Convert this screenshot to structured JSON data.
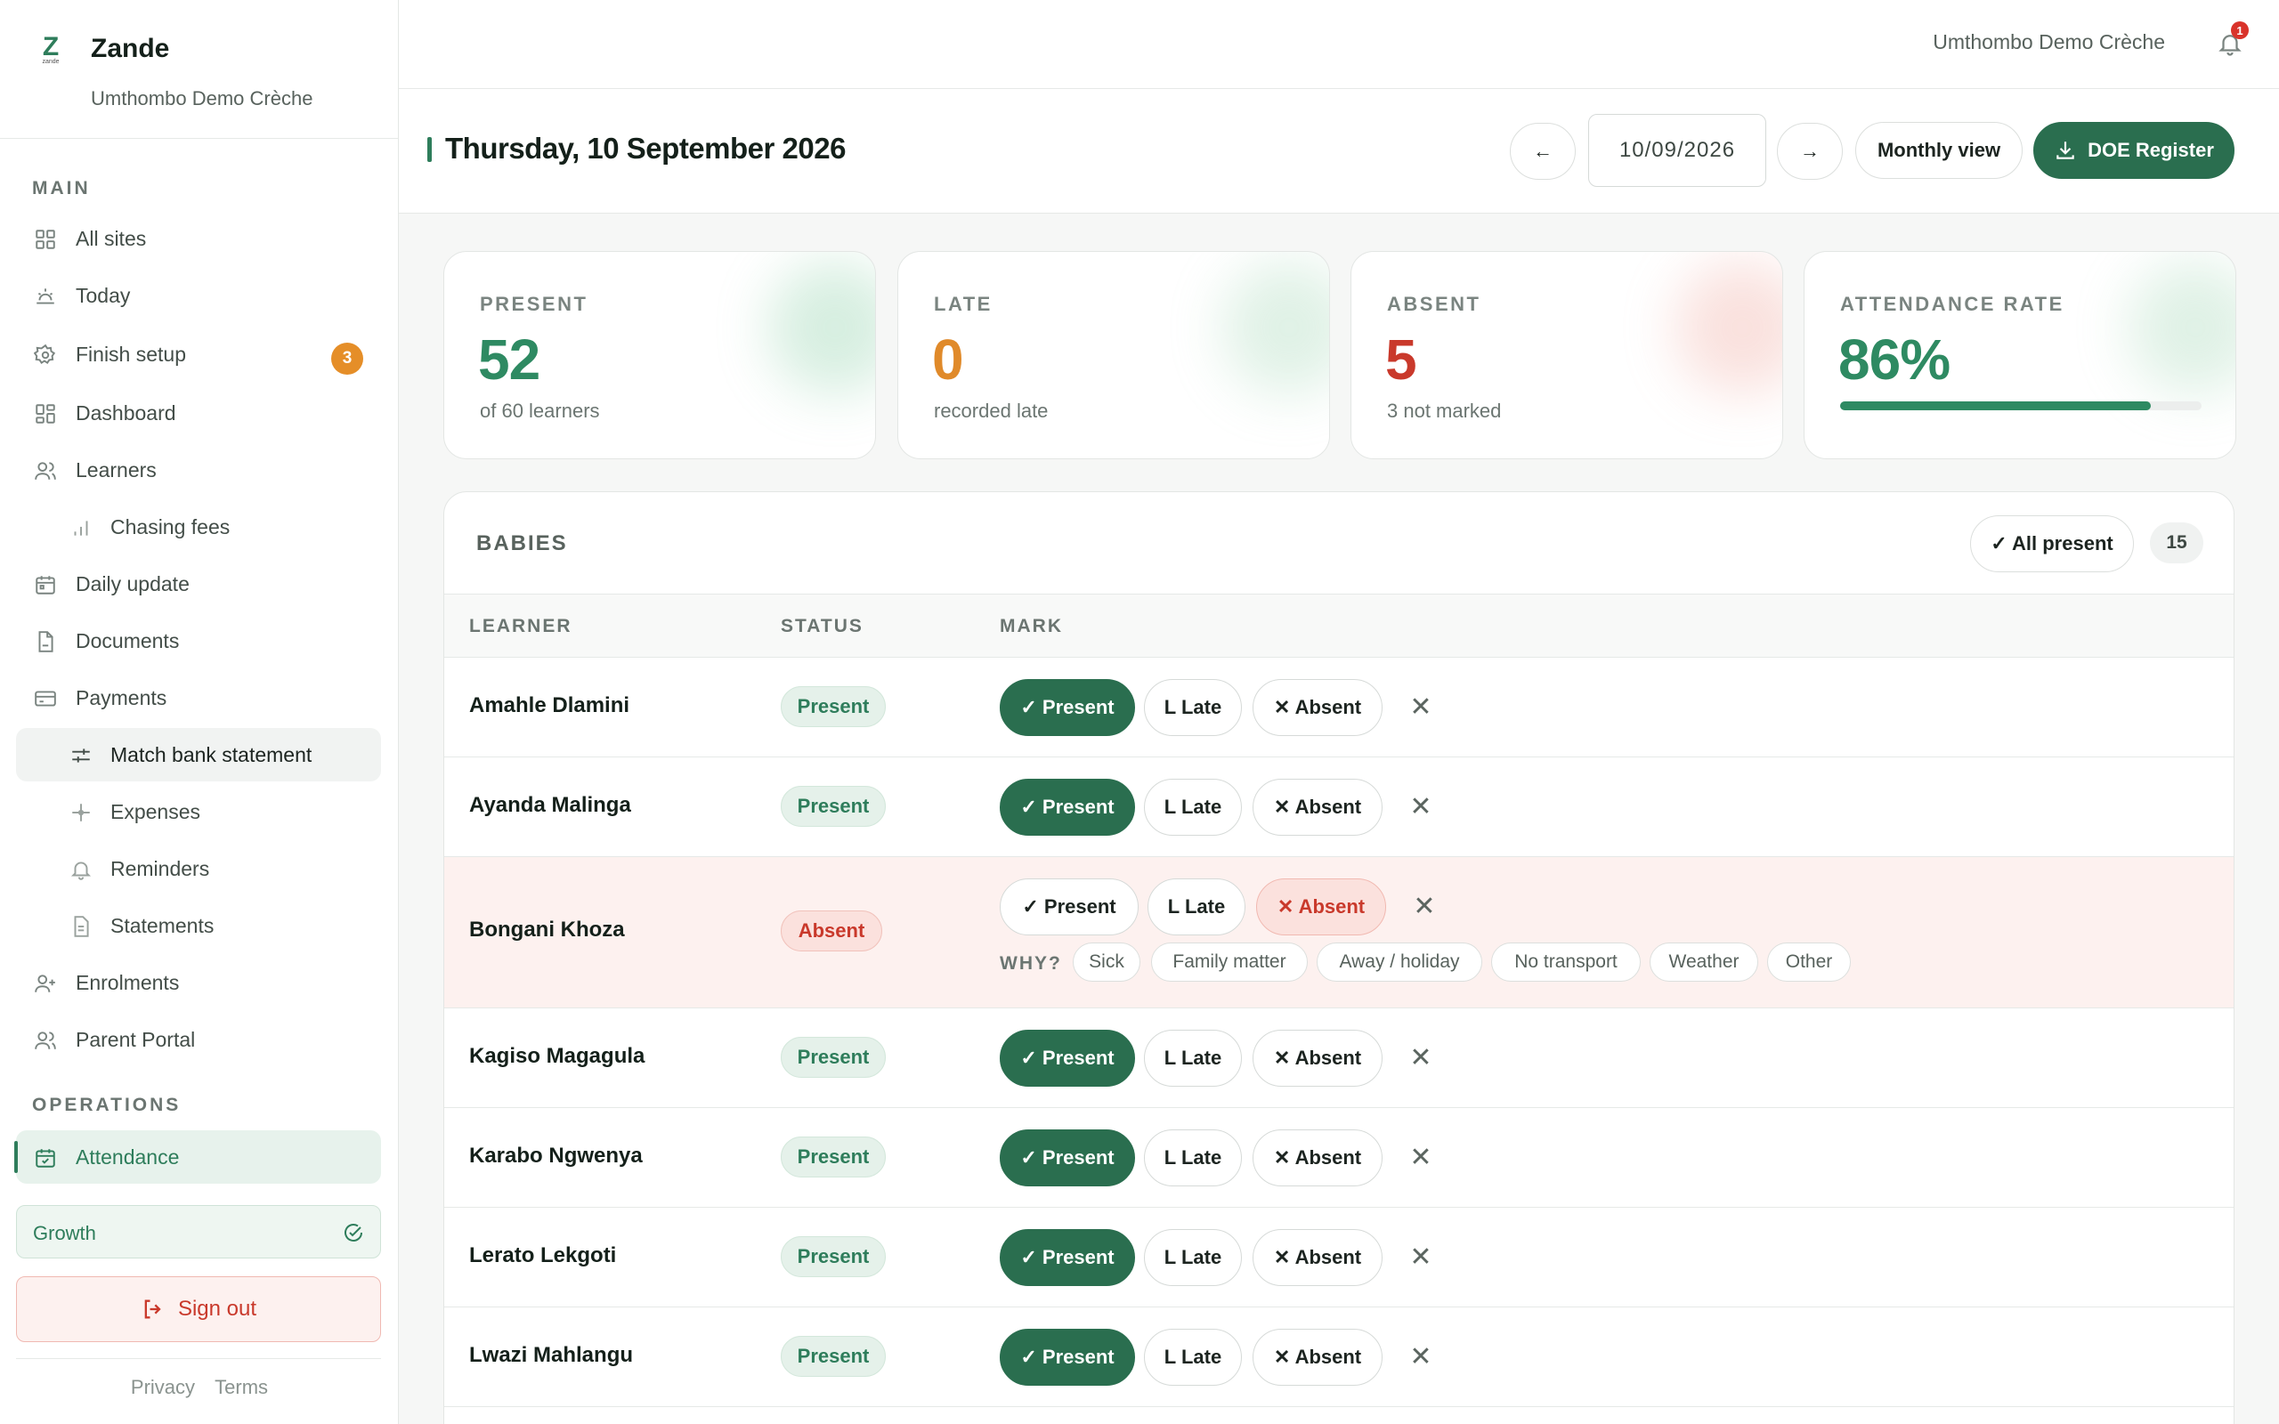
{
  "app": {
    "name": "Zande",
    "org": "Umthombo Demo Crèche",
    "logo_letter": "Z",
    "logo_word": "zande"
  },
  "sidebar": {
    "main_label": "MAIN",
    "items": [
      {
        "label": "All sites",
        "icon": "grid-icon"
      },
      {
        "label": "Today",
        "icon": "sun-icon"
      },
      {
        "label": "Finish setup",
        "icon": "gear-icon",
        "badge": "3"
      },
      {
        "label": "Dashboard",
        "icon": "dashboard-icon"
      },
      {
        "label": "Learners",
        "icon": "users-icon"
      },
      {
        "label": "Chasing fees",
        "icon": "bar-chart-icon"
      },
      {
        "label": "Daily update",
        "icon": "calendar-icon"
      },
      {
        "label": "Documents",
        "icon": "document-icon"
      },
      {
        "label": "Payments",
        "icon": "card-icon"
      },
      {
        "label": "Match bank statement",
        "icon": "sliders-icon"
      },
      {
        "label": "Expenses",
        "icon": "sparkle-icon"
      },
      {
        "label": "Reminders",
        "icon": "bell-icon"
      },
      {
        "label": "Statements",
        "icon": "file-icon"
      },
      {
        "label": "Enrolments",
        "icon": "user-plus-icon"
      },
      {
        "label": "Parent Portal",
        "icon": "users-icon"
      }
    ],
    "operations_label": "OPERATIONS",
    "active_item": {
      "label": "Attendance",
      "icon": "calendar-check-icon"
    },
    "plan": {
      "label": "Growth"
    },
    "sign_out": "Sign out",
    "footer": {
      "privacy": "Privacy",
      "terms": "Terms"
    }
  },
  "topbar": {
    "org": "Umthombo Demo Crèche",
    "notifications": "1"
  },
  "header": {
    "title": "Thursday, 10 September 2026",
    "date_value": "10/09/2026",
    "prev": "←",
    "next": "→",
    "monthly": "Monthly view",
    "doe": "DOE Register"
  },
  "stats": [
    {
      "label": "PRESENT",
      "value": "52",
      "sub": "of 60 learners",
      "color": "#2e8a62"
    },
    {
      "label": "LATE",
      "value": "0",
      "sub": "recorded late",
      "color": "#e08a2a"
    },
    {
      "label": "ABSENT",
      "value": "5",
      "sub": "3 not marked",
      "color": "#c9392b"
    },
    {
      "label": "ATTENDANCE RATE",
      "value": "86%",
      "progress": 0.86,
      "color": "#2e8a62"
    }
  ],
  "group": {
    "title": "BABIES",
    "all_present": "✓ All present",
    "count": "15",
    "columns": [
      "LEARNER",
      "STATUS",
      "MARK"
    ],
    "buttons": {
      "present": "✓ Present",
      "late": "L Late",
      "absent": "✕ Absent",
      "clear": "✕"
    },
    "why_label": "WHY?",
    "reasons": [
      "Sick",
      "Family matter",
      "Away / holiday",
      "No transport",
      "Weather",
      "Other"
    ],
    "learners": [
      {
        "name": "Amahle Dlamini",
        "status": "Present"
      },
      {
        "name": "Ayanda Malinga",
        "status": "Present"
      },
      {
        "name": "Bongani Khoza",
        "status": "Absent"
      },
      {
        "name": "Kagiso Magagula",
        "status": "Present"
      },
      {
        "name": "Karabo Ngwenya",
        "status": "Present"
      },
      {
        "name": "Lerato Lekgoti",
        "status": "Present"
      },
      {
        "name": "Lwazi Mahlangu",
        "status": "Present"
      }
    ]
  }
}
